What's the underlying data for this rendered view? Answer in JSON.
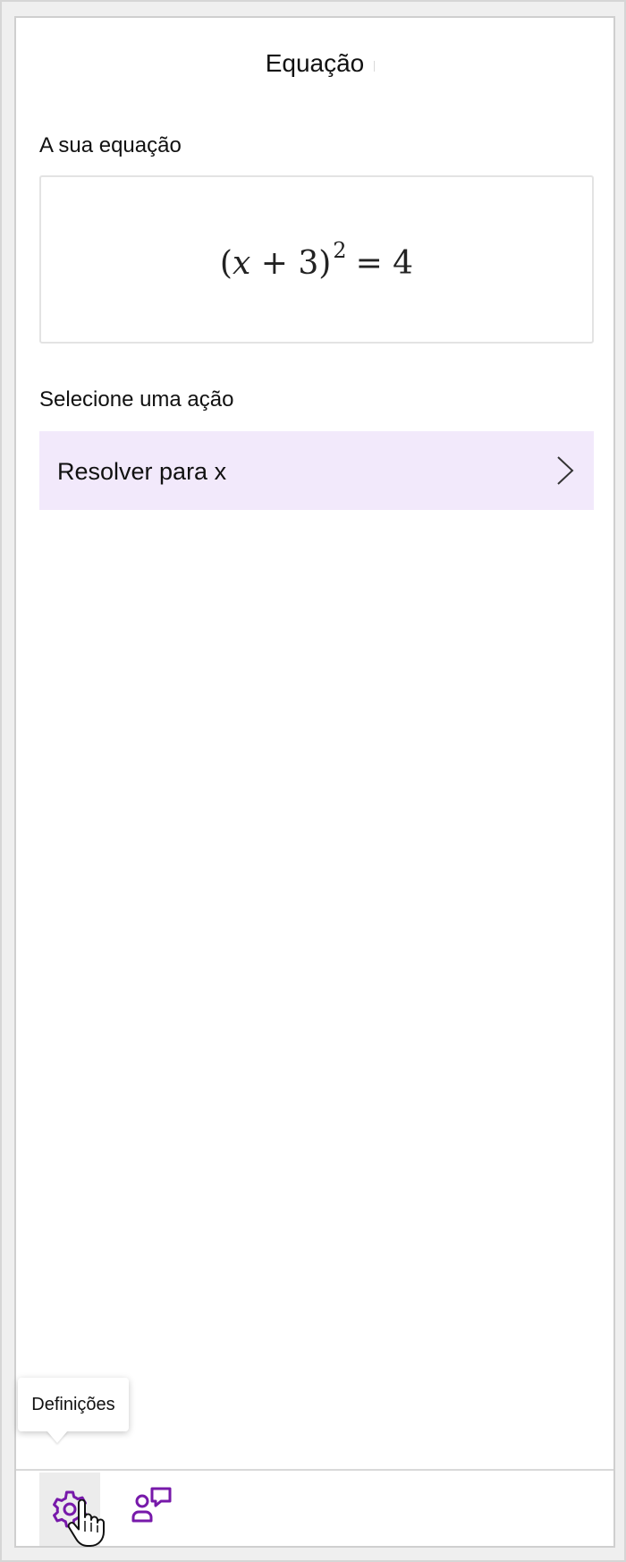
{
  "header": {
    "title": "Equação"
  },
  "equation_section": {
    "label": "A sua equação",
    "equation": {
      "open_paren": "(",
      "var": "x",
      "plus": " + 3",
      "close_paren": ")",
      "exponent": "2",
      "rhs": "= 4"
    }
  },
  "action_section": {
    "label": "Selecione uma ação",
    "actions": [
      {
        "label": "Resolver para x"
      }
    ]
  },
  "footer": {
    "settings_tooltip": "Definições",
    "settings_icon": "gear-icon",
    "feedback_icon": "feedback-icon"
  },
  "colors": {
    "accent": "#7719aa",
    "action_bg": "#f2e9fb",
    "panel_border": "#cfcfcf"
  }
}
